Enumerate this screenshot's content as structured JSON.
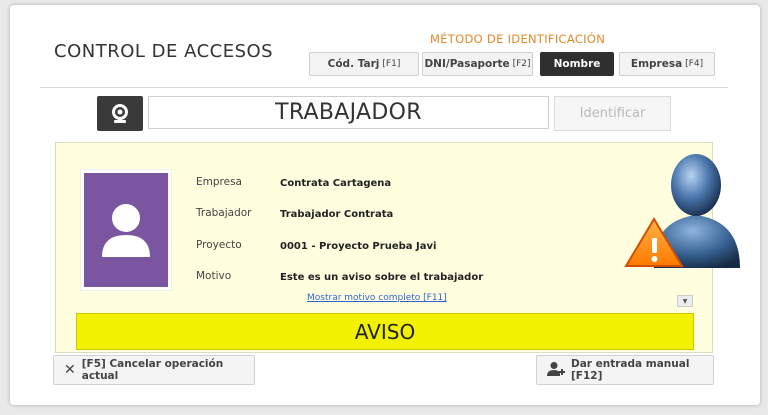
{
  "header": {
    "title": "CONTROL DE ACCESOS",
    "method_label": "MÉTODO DE IDENTIFICACIÓN",
    "methods": [
      {
        "label": "Cód. Tarj",
        "key": "[F1]"
      },
      {
        "label": "DNI/Pasaporte",
        "key": "[F2]"
      },
      {
        "label": "Nombre",
        "key": ""
      },
      {
        "label": "Empresa",
        "key": "[F4]"
      }
    ],
    "active_method": "Nombre"
  },
  "search": {
    "value": "TRABAJADOR",
    "identify_label": "Identificar"
  },
  "worker": {
    "fields": [
      {
        "label": "Empresa",
        "value": "Contrata Cartagena"
      },
      {
        "label": "Trabajador",
        "value": "Trabajador Contrata"
      },
      {
        "label": "Proyecto",
        "value": "0001 - Proyecto Prueba Javi"
      },
      {
        "label": "Motivo",
        "value": "Este es un aviso sobre el trabajador"
      }
    ],
    "more_link": "Mostrar motivo completo [F11]",
    "status": "AVISO",
    "photo_color": "#7a56a0"
  },
  "footer": {
    "cancel_label": "[F5] Cancelar operación actual",
    "manual_entry_label": "Dar entrada manual [F12]"
  },
  "icons": [
    "webcam-icon",
    "user-placeholder-icon",
    "warning-user-icon",
    "close-icon",
    "add-user-icon",
    "scroll-down-icon"
  ],
  "colors": {
    "accent": "#e08a2a",
    "status_bg": "#f2f200",
    "panel_bg": "#ffffe0",
    "active_btn": "#2f2f2f"
  }
}
